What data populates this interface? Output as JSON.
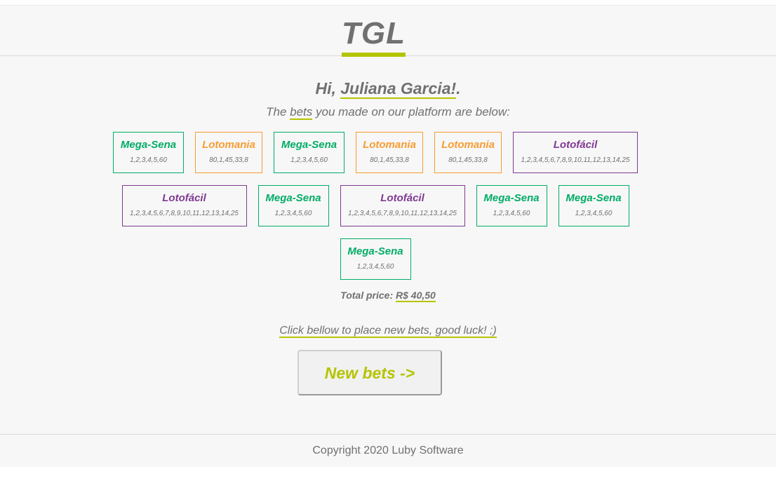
{
  "header": {
    "logo": "TGL"
  },
  "greeting": {
    "prefix": "Hi, ",
    "name": "Juliana Garcia!",
    "suffix": "."
  },
  "subtitle": {
    "before": "The ",
    "link": "bets",
    "after": " you made on our platform are below:"
  },
  "colors": {
    "accent": "#b5c401",
    "mega_sena": "#01ac66",
    "lotomania": "#f79c31",
    "lotofacil": "#7f3992",
    "text": "#707070"
  },
  "bets": [
    {
      "game": "Mega-Sena",
      "numbers": "1,2,3,4,5,60",
      "color": "#01ac66"
    },
    {
      "game": "Lotomania",
      "numbers": "80,1,45,33,8",
      "color": "#f79c31"
    },
    {
      "game": "Mega-Sena",
      "numbers": "1,2,3,4,5,60",
      "color": "#01ac66"
    },
    {
      "game": "Lotomania",
      "numbers": "80,1,45,33,8",
      "color": "#f79c31"
    },
    {
      "game": "Lotomania",
      "numbers": "80,1,45,33,8",
      "color": "#f79c31"
    },
    {
      "game": "Lotofácil",
      "numbers": "1,2,3,4,5,6,7,8,9,10,11,12,13,14,25",
      "color": "#7f3992"
    },
    {
      "game": "Lotofácil",
      "numbers": "1,2,3,4,5,6,7,8,9,10,11,12,13,14,25",
      "color": "#7f3992"
    },
    {
      "game": "Mega-Sena",
      "numbers": "1,2,3,4,5,60",
      "color": "#01ac66"
    },
    {
      "game": "Lotofácil",
      "numbers": "1,2,3,4,5,6,7,8,9,10,11,12,13,14,25",
      "color": "#7f3992"
    },
    {
      "game": "Mega-Sena",
      "numbers": "1,2,3,4,5,60",
      "color": "#01ac66"
    },
    {
      "game": "Mega-Sena",
      "numbers": "1,2,3,4,5,60",
      "color": "#01ac66"
    },
    {
      "game": "Mega-Sena",
      "numbers": "1,2,3,4,5,60",
      "color": "#01ac66"
    }
  ],
  "total": {
    "label": "Total price: ",
    "amount": "R$ 40,50"
  },
  "cta": {
    "text": "Click bellow to place new bets, good luck! ;)",
    "button_label": "New bets ->"
  },
  "footer": {
    "copyright": "Copyright 2020 Luby Software"
  }
}
